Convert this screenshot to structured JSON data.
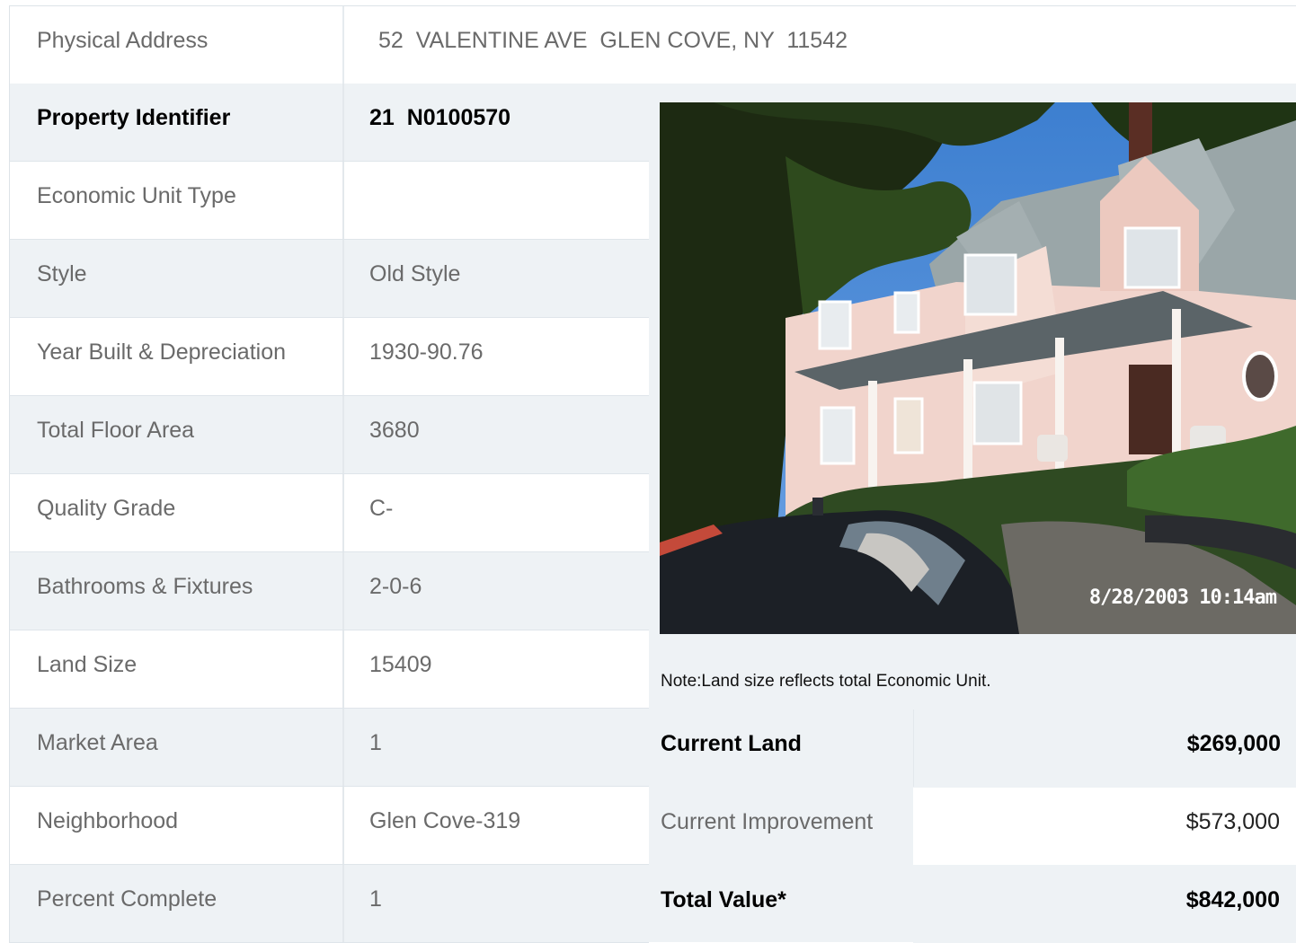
{
  "address": {
    "label": "Physical Address",
    "value": "52  VALENTINE AVE  GLEN COVE, NY  11542"
  },
  "details": [
    {
      "label": "Property Identifier",
      "value": "21  N0100570",
      "bold": true
    },
    {
      "label": "Economic Unit Type",
      "value": ""
    },
    {
      "label": "Style",
      "value": "Old Style"
    },
    {
      "label": "Year Built & Depreciation",
      "value": "1930-90.76"
    },
    {
      "label": "Total Floor Area",
      "value": "3680"
    },
    {
      "label": "Quality Grade",
      "value": "C-"
    },
    {
      "label": "Bathrooms & Fixtures",
      "value": "2-0-6"
    },
    {
      "label": "Land Size",
      "value": "15409"
    },
    {
      "label": "Market Area",
      "value": "1"
    },
    {
      "label": "Neighborhood",
      "value": "Glen Cove-319"
    },
    {
      "label": "Percent Complete",
      "value": "1"
    }
  ],
  "photo": {
    "timestamp": "8/28/2003 10:14am"
  },
  "note": "Note:Land size reflects total Economic Unit.",
  "values": {
    "current_land": {
      "label": "Current Land",
      "value": "$269,000"
    },
    "current_improvement": {
      "label": "Current Improvement",
      "value": "$573,000"
    },
    "total_value": {
      "label": "Total Value*",
      "value": "$842,000"
    }
  }
}
